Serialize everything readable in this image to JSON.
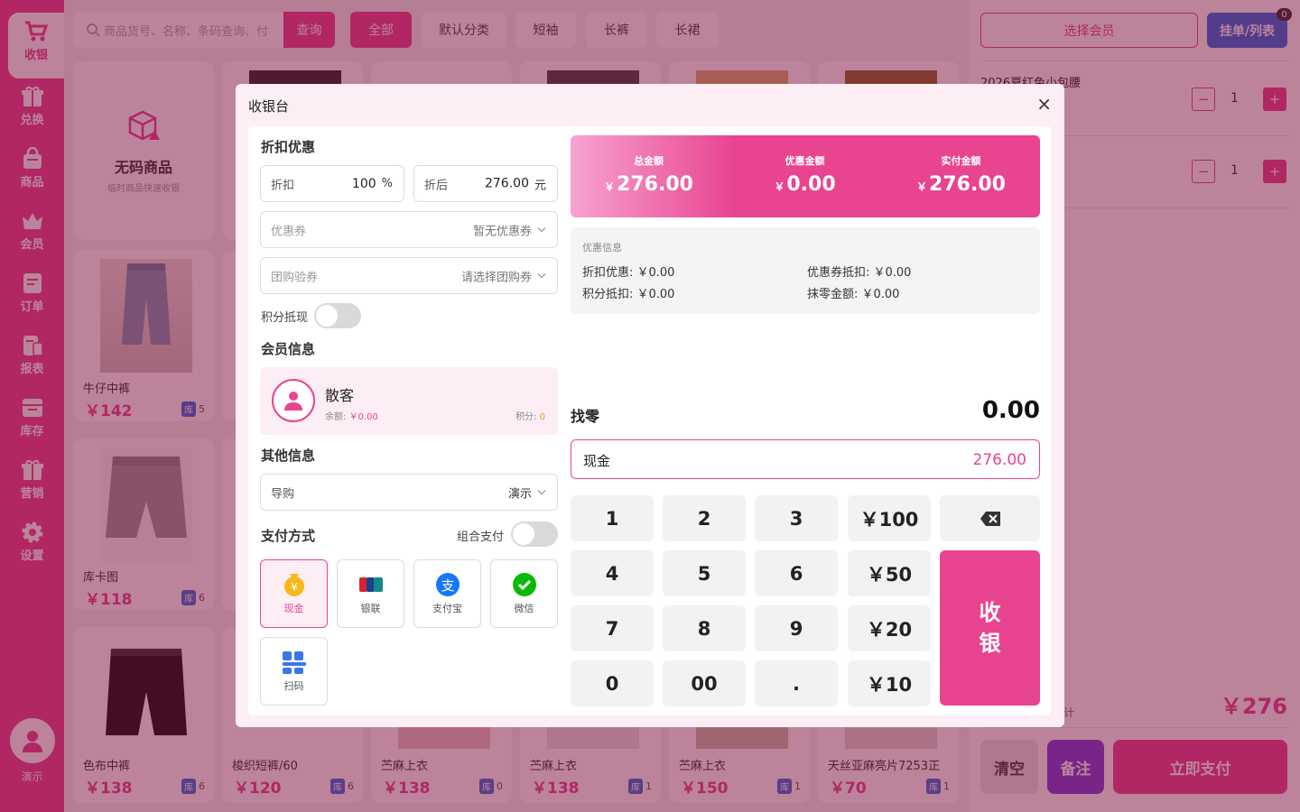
{
  "sidebar": {
    "items": [
      {
        "label": "收银",
        "icon": "cart-icon"
      },
      {
        "label": "兑换",
        "icon": "gift-icon"
      },
      {
        "label": "商品",
        "icon": "bag-icon"
      },
      {
        "label": "会员",
        "icon": "crown-icon"
      },
      {
        "label": "订单",
        "icon": "order-icon"
      },
      {
        "label": "报表",
        "icon": "report-icon"
      },
      {
        "label": "库存",
        "icon": "inventory-icon"
      },
      {
        "label": "营销",
        "icon": "marketing-icon"
      },
      {
        "label": "设置",
        "icon": "gear-icon"
      }
    ],
    "user": {
      "name": "演示"
    }
  },
  "topbar": {
    "search_placeholder": "商品货号、名称、条码查询、付",
    "search_button": "查询",
    "categories": [
      "全部",
      "默认分类",
      "短袖",
      "长裤",
      "长裙"
    ]
  },
  "nocode": {
    "title": "无码商品",
    "subtitle": "临时商品快速收银"
  },
  "products": [
    {
      "name": "牛仔中裤",
      "price": "￥142",
      "stock_label": "库",
      "stock": "5"
    },
    {
      "name": "库卡图",
      "price": "￥118",
      "stock_label": "库",
      "stock": "6"
    },
    {
      "name": "色布中裤",
      "price": "￥138",
      "stock_label": "库",
      "stock": "6"
    },
    {
      "name": "梭织短裤/60",
      "price": "￥120",
      "stock_label": "库",
      "stock": "6"
    },
    {
      "name": "苎麻上衣",
      "price": "￥138",
      "stock_label": "库",
      "stock": "0"
    },
    {
      "name": "苎麻上衣",
      "price": "￥138",
      "stock_label": "库",
      "stock": "1"
    },
    {
      "name": "苎麻上衣",
      "price": "￥150",
      "stock_label": "库",
      "stock": "1"
    },
    {
      "name": "天丝亚麻亮片7253正",
      "price": "￥70",
      "stock_label": "库",
      "stock": "1"
    }
  ],
  "cart": {
    "member_button": "选择会员",
    "hang_button": "挂单/列表",
    "hang_count": "0",
    "items": [
      {
        "name": "2026夏红色小包腰",
        "qty": "1"
      },
      {
        "name": "",
        "qty": "1"
      }
    ],
    "total_label": "计",
    "total": "￥276",
    "clear_button": "清空",
    "note_button": "备注",
    "pay_button": "立即支付"
  },
  "modal": {
    "title": "收银台",
    "close": "×",
    "discount_section": "折扣优惠",
    "discount_label": "折扣",
    "discount_value": "100",
    "discount_unit": "%",
    "after_label": "折后",
    "after_value": "276.00",
    "after_unit": "元",
    "coupon_label": "优惠券",
    "coupon_value": "暂无优惠券",
    "group_label": "团购验券",
    "group_value": "请选择团购券",
    "points_label": "积分抵现",
    "member_section": "会员信息",
    "member_name": "散客",
    "balance_label": "余额:",
    "balance_value": "￥0.00",
    "points_short": "积分:",
    "points_value": "0",
    "other_section": "其他信息",
    "guide_label": "导购",
    "guide_value": "演示",
    "payment_section": "支付方式",
    "combo_label": "组合支付",
    "payment_methods": [
      "现金",
      "银联",
      "支付宝",
      "微信",
      "扫码"
    ],
    "summary": [
      {
        "label": "总金额",
        "currency": "￥",
        "value": "276.00"
      },
      {
        "label": "优惠金额",
        "currency": "￥",
        "value": "0.00"
      },
      {
        "label": "实付金额",
        "currency": "￥",
        "value": "276.00"
      }
    ],
    "info_title": "优惠信息",
    "info": {
      "discount": "折扣优惠: ￥0.00",
      "coupon": "优惠券抵扣: ￥0.00",
      "points": "积分抵扣: ￥0.00",
      "rounding": "抹零金额: ￥0.00"
    },
    "change_label": "找零",
    "change_value": "0.00",
    "cash_label": "现金",
    "cash_value": "276.00",
    "keypad": [
      "1",
      "2",
      "3",
      "￥100",
      "4",
      "5",
      "6",
      "￥50",
      "7",
      "8",
      "9",
      "￥20",
      "0",
      "00",
      ".",
      "￥10"
    ],
    "checkout_key": "收银"
  },
  "colors": {
    "accent": "#e8448f",
    "blue": "#2f6fe0",
    "purple": "#7a3fd8"
  }
}
